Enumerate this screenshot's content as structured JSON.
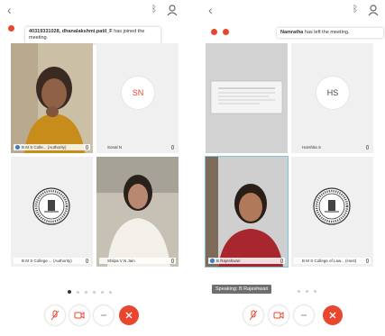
{
  "left": {
    "toast": {
      "id": "40319331028,",
      "name": "dhanalakshmi.patil_F",
      "suffix": "has joined the meeting."
    },
    "tiles": [
      {
        "label": "B M S Colle... (Authority)"
      },
      {
        "initials": "SN",
        "label": "Sonal N"
      },
      {
        "label": "B M S College ... (Authority)"
      },
      {
        "label": "Shilpa V N Jain"
      }
    ]
  },
  "right": {
    "toast": {
      "name": "Namratha",
      "suffix": "has left the meeting."
    },
    "tiles": [
      {},
      {
        "initials": "HS",
        "label": "Harshita S"
      },
      {
        "label": "B Rajeshwari"
      },
      {
        "label": "B M S College of Law... (Host)"
      }
    ],
    "speaking": "Speaking: B Rajeshwari"
  },
  "icons": [
    "back-chevron-icon",
    "bluetooth-icon",
    "participants-icon",
    "mic-off-icon",
    "video-off-icon",
    "more-icon",
    "close-icon"
  ],
  "colors": {
    "accent": "#e8462e",
    "active_tile_border": "#7fc4d4"
  }
}
